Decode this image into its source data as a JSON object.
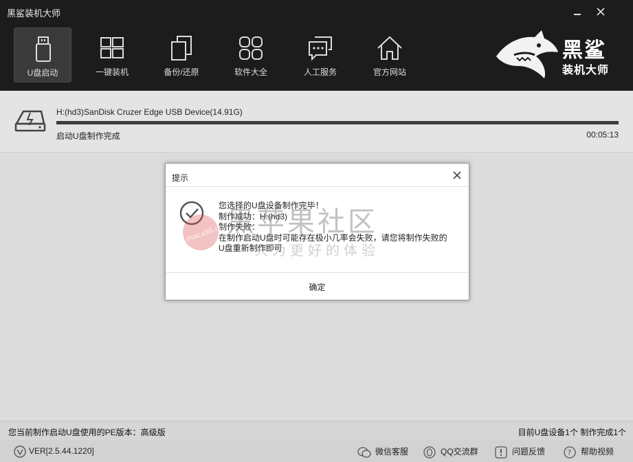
{
  "app": {
    "title": "黑鲨装机大师",
    "minimize_icon": "minimize-icon",
    "close_icon": "close-icon"
  },
  "nav": {
    "items": [
      {
        "label": "U盘启动",
        "icon": "usb-drive-icon",
        "active": true
      },
      {
        "label": "一键装机",
        "icon": "windows-icon",
        "active": false
      },
      {
        "label": "备份/还原",
        "icon": "copy-icon",
        "active": false
      },
      {
        "label": "软件大全",
        "icon": "apps-grid-icon",
        "active": false
      },
      {
        "label": "人工服务",
        "icon": "chat-icon",
        "active": false
      },
      {
        "label": "官方网站",
        "icon": "home-icon",
        "active": false
      }
    ]
  },
  "logo": {
    "line1": "黑鲨",
    "line2": "装机大师"
  },
  "device": {
    "name": "H:(hd3)SanDisk Cruzer Edge USB Device(14.91G)",
    "status": "启动U盘制作完成",
    "elapsed": "00:05:13",
    "progress": 1.0
  },
  "dialog": {
    "title": "提示",
    "lines": [
      "您选择的U盘设备制作完毕！",
      "制作成功：H:(hd3)",
      "制作失败：",
      "在制作启动U盘时可能存在极小几率会失败，请您将制作失败的",
      "U盘重新制作即可"
    ],
    "ok_label": "确定"
  },
  "watermark": {
    "main": "黑苹果社区",
    "sub": "只为更好的体验",
    "logo_text": "macx86.cn"
  },
  "infobar": {
    "left": "您当前制作启动U盘使用的PE版本：高级版",
    "right": "目前U盘设备1个 制作完成1个"
  },
  "footer": {
    "version": "VER[2.5.44.1220]",
    "links": [
      {
        "label": "微信客服",
        "icon": "wechat-icon"
      },
      {
        "label": "QQ交流群",
        "icon": "qq-icon"
      },
      {
        "label": "问题反馈",
        "icon": "feedback-icon"
      },
      {
        "label": "帮助视频",
        "icon": "help-icon"
      }
    ]
  },
  "colors": {
    "topbar": "#1c1c1c",
    "main_bg": "#dcdcdc",
    "dialog_bg": "#ffffff",
    "progress_fill": "#3c3c3c"
  }
}
